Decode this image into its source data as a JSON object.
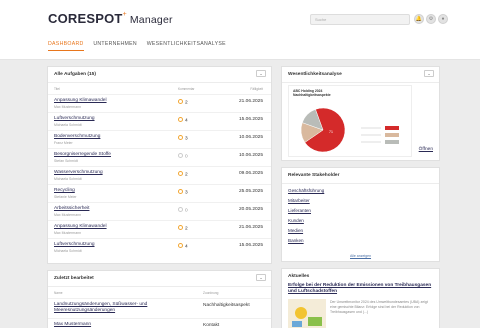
{
  "header": {
    "brand": "CORESPOT",
    "brand_sup": "+",
    "app_name": "Manager",
    "search_placeholder": "Suche",
    "icons": [
      "bell-icon",
      "settings-icon",
      "user-icon"
    ]
  },
  "nav": {
    "tabs": [
      {
        "label": "DASHBOARD",
        "active": true
      },
      {
        "label": "UNTERNEHMEN",
        "active": false
      },
      {
        "label": "WESENTLICHKEITSANALYSE",
        "active": false
      }
    ]
  },
  "tasks": {
    "title": "Alle Aufgaben (15)",
    "columns": {
      "title": "Titel",
      "comments": "Kommentar",
      "due": "Fälligkeit"
    },
    "rows": [
      {
        "name": "Anpassung Klimawandel",
        "person": "Max Mustermann",
        "count": "2",
        "due": "21.06.2025"
      },
      {
        "name": "Luftverschmutzung",
        "person": "Michaela Schmidt",
        "count": "4",
        "due": "15.06.2025"
      },
      {
        "name": "Bodenverschmutzung",
        "person": "Franz Meier",
        "count": "3",
        "due": "10.06.2025"
      },
      {
        "name": "Besorgniserregende Stoffe",
        "person": "Stefan Schmidt",
        "count": "0",
        "due": "10.06.2025"
      },
      {
        "name": "Wasserverschmutzung",
        "person": "Michaela Schmidt",
        "count": "2",
        "due": "09.06.2025"
      },
      {
        "name": "Recycling",
        "person": "Stefanie Meier",
        "count": "3",
        "due": "25.05.2025"
      },
      {
        "name": "Arbeitssicherheit",
        "person": "Max Mustermann",
        "count": "0",
        "due": "20.05.2025"
      },
      {
        "name": "Anpassung Klimawandel",
        "person": "Max Mustermann",
        "count": "2",
        "due": "21.06.2025"
      },
      {
        "name": "Luftverschmutzung",
        "person": "Michaela Schmidt",
        "count": "4",
        "due": "15.06.2025"
      }
    ]
  },
  "recent": {
    "title": "Zuletzt bearbeitet",
    "columns": {
      "name": "Name",
      "type": "Zuordnung"
    },
    "rows": [
      {
        "name": "Landnutzungsänderungen, Süßwasser- und Meeresnutzungsänderungen",
        "type": "Nachhaltigkeitsaspekt"
      },
      {
        "name": "Max Mustermann",
        "type": "Kontakt"
      }
    ]
  },
  "analysis": {
    "title": "Wesentlichkeitsanalyse",
    "chart_title": "ABC Holding 2024 Nachhaltigkeitsaspekte",
    "open_link": "Öffnen"
  },
  "chart_data": {
    "type": "pie",
    "title": "ABC Holding 2024 Nachhaltigkeitsaspekte",
    "slices": [
      {
        "label": "",
        "value": 71,
        "color": "#d42a2a"
      },
      {
        "label": "",
        "value": 15,
        "color": "#d9b99e"
      },
      {
        "label": "",
        "value": 14,
        "color": "#b9bcb8"
      }
    ],
    "data_labels": [
      "71"
    ],
    "legend_placement": "right"
  },
  "stakeholders": {
    "title": "Relevante Stakeholder",
    "items": [
      "Geschäftsführung",
      "Mitarbeiter",
      "Lieferanten",
      "Kunden",
      "Medien",
      "Banken"
    ],
    "show_all": "Alle anzeigen"
  },
  "news": {
    "title": "Aktuelles",
    "headline": "Erfolge bei der Reduktion der Emissionen von Treibhausgasen und Luftschadstoffen",
    "excerpt": "Der Umweltmonitor 2024 des Umweltbundesamtes (UBA) zeigt eine gemischte Bilanz: Erfolge sind bei der Reduktion von Treibhausgasen und (...)"
  },
  "colors": {
    "accent": "#e8761c",
    "link": "#2a2a55",
    "pie_red": "#d42a2a"
  }
}
